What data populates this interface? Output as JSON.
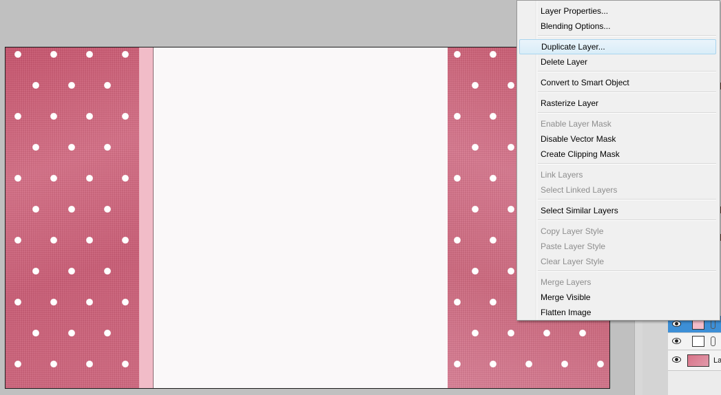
{
  "context_menu": {
    "items": [
      {
        "label": "Layer Properties...",
        "enabled": true
      },
      {
        "label": "Blending Options...",
        "enabled": true
      },
      {
        "label": "Duplicate Layer...",
        "enabled": true,
        "highlighted": true
      },
      {
        "label": "Delete Layer",
        "enabled": true
      },
      {
        "label": "Convert to Smart Object",
        "enabled": true
      },
      {
        "label": "Rasterize Layer",
        "enabled": true
      },
      {
        "label": "Enable Layer Mask",
        "enabled": false
      },
      {
        "label": "Disable Vector Mask",
        "enabled": true
      },
      {
        "label": "Create Clipping Mask",
        "enabled": true
      },
      {
        "label": "Link Layers",
        "enabled": false
      },
      {
        "label": "Select Linked Layers",
        "enabled": false
      },
      {
        "label": "Select Similar Layers",
        "enabled": true
      },
      {
        "label": "Copy Layer Style",
        "enabled": false
      },
      {
        "label": "Paste Layer Style",
        "enabled": false
      },
      {
        "label": "Clear Layer Style",
        "enabled": false
      },
      {
        "label": "Merge Layers",
        "enabled": false
      },
      {
        "label": "Merge Visible",
        "enabled": true
      },
      {
        "label": "Flatten Image",
        "enabled": true
      }
    ]
  },
  "layers_panel": {
    "layers": [
      {
        "name": "",
        "thumbnail": "pink-swatch",
        "visible": true,
        "selected": true
      },
      {
        "name": "",
        "thumbnail": "white-swatch",
        "visible": true,
        "selected": false
      },
      {
        "name": "La",
        "thumbnail": "pattern",
        "visible": true,
        "selected": false
      }
    ]
  },
  "colors": {
    "polka_pink": "#cd5f79",
    "band_pink": "#f1bcc8",
    "canvas_white": "#faf8f9",
    "menu_highlight": "#d9edf8",
    "selected_layer": "#3d8fd6"
  }
}
